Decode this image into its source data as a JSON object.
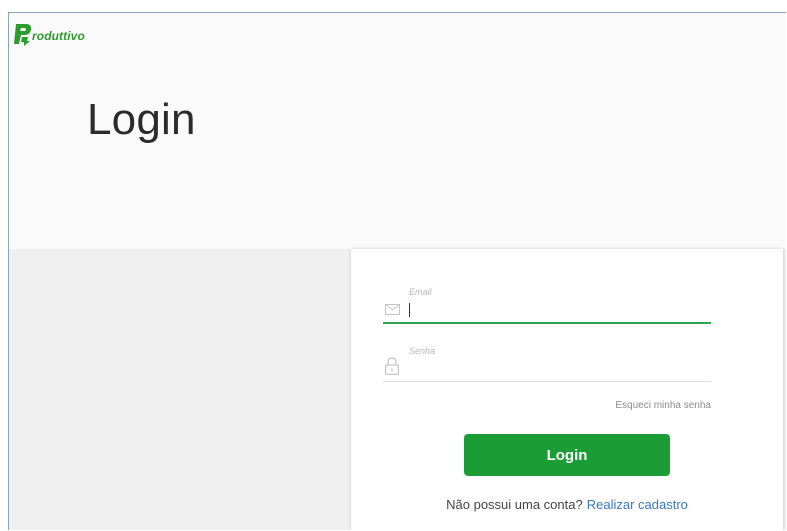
{
  "brand": {
    "logo_text": "roduttivo",
    "colors": {
      "primary": "#1c9c34",
      "logo": "#2e9b2e",
      "link": "#3a78c2"
    }
  },
  "page": {
    "title": "Login"
  },
  "form": {
    "email": {
      "label": "Email",
      "value": "",
      "icon": "envelope-icon"
    },
    "password": {
      "label": "Senha",
      "value": "",
      "icon": "lock-icon"
    },
    "forgot_password": "Esqueci minha senha",
    "submit_label": "Login",
    "signup_prompt": "Não possui uma conta?",
    "signup_link": "Realizar cadastro"
  }
}
